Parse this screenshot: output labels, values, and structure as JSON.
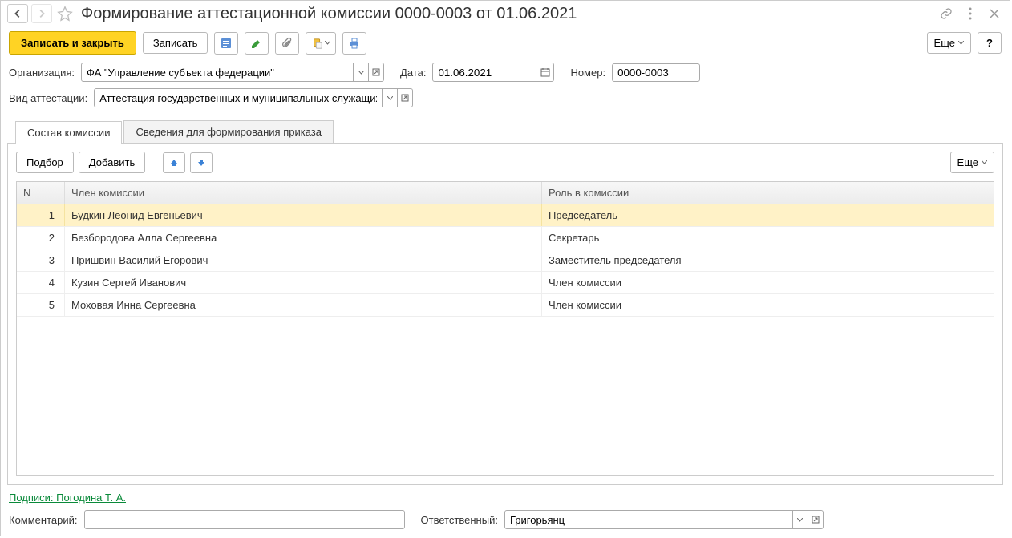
{
  "title": "Формирование аттестационной комиссии 0000-0003 от 01.06.2021",
  "toolbar": {
    "save_close": "Записать и закрыть",
    "save": "Записать",
    "more": "Еще",
    "help": "?"
  },
  "form": {
    "org_label": "Организация:",
    "org_value": "ФА \"Управление субъекта федерации\"",
    "date_label": "Дата:",
    "date_value": "01.06.2021",
    "number_label": "Номер:",
    "number_value": "0000-0003",
    "attest_type_label": "Вид аттестации:",
    "attest_type_value": "Аттестация государственных и муниципальных служащих"
  },
  "tabs": {
    "composition": "Состав комиссии",
    "order_info": "Сведения для формирования приказа"
  },
  "tab_controls": {
    "select": "Подбор",
    "add": "Добавить",
    "more": "Еще"
  },
  "table": {
    "headers": {
      "n": "N",
      "member": "Член комиссии",
      "role": "Роль в комиссии"
    },
    "rows": [
      {
        "n": "1",
        "member": "Будкин Леонид Евгеньевич",
        "role": "Председатель",
        "selected": true
      },
      {
        "n": "2",
        "member": "Безбородова Алла Сергеевна",
        "role": "Секретарь",
        "selected": false
      },
      {
        "n": "3",
        "member": "Пришвин Василий Егорович",
        "role": "Заместитель председателя",
        "selected": false
      },
      {
        "n": "4",
        "member": "Кузин Сергей Иванович",
        "role": "Член комиссии",
        "selected": false
      },
      {
        "n": "5",
        "member": "Моховая Инна Сергеевна",
        "role": "Член комиссии",
        "selected": false
      }
    ]
  },
  "footer": {
    "signatures": "Подписи: Погодина Т. А.",
    "comment_label": "Комментарий:",
    "comment_value": "",
    "responsible_label": "Ответственный:",
    "responsible_value": "Григорьянц"
  }
}
